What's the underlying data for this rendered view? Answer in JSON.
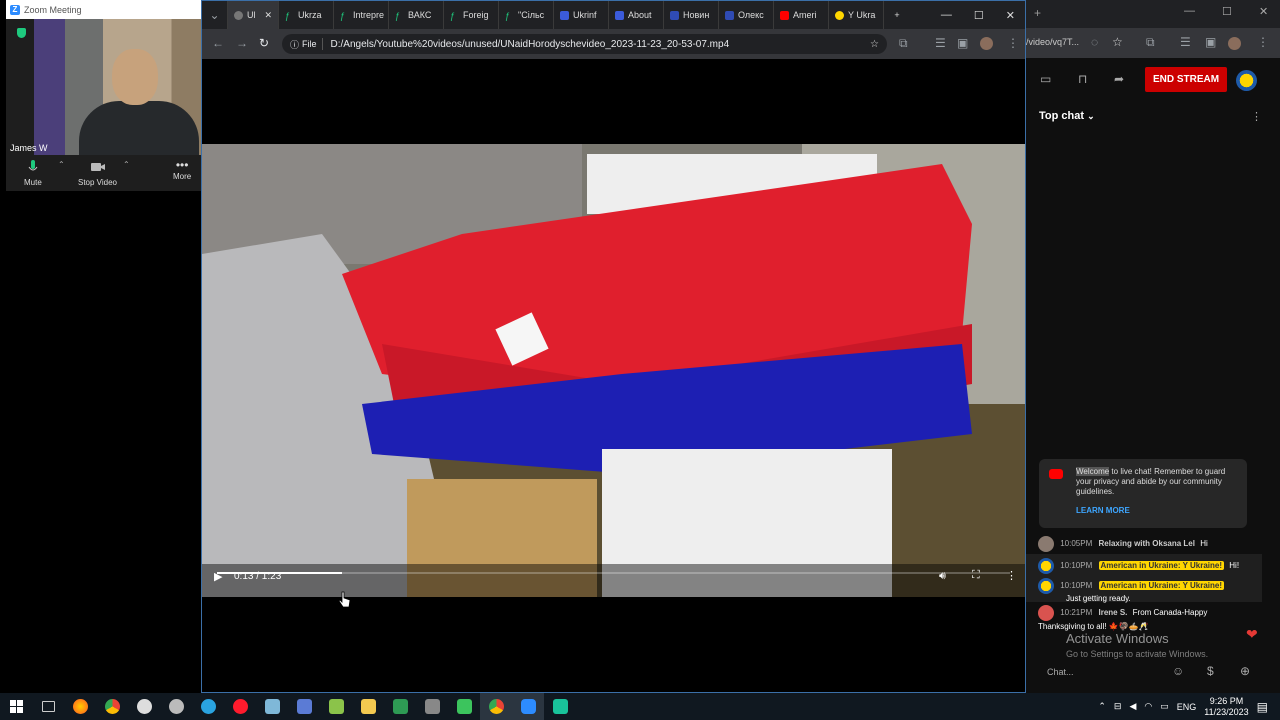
{
  "zoom": {
    "title": "Zoom Meeting",
    "participant_name": "James W",
    "controls": {
      "mute": "Mute",
      "stop_video": "Stop Video",
      "more": "More"
    }
  },
  "chrome": {
    "tabs": [
      {
        "label": "Ul",
        "active": true
      },
      {
        "label": "Ukrza"
      },
      {
        "label": "Intrepre"
      },
      {
        "label": "ВАКС"
      },
      {
        "label": "Foreig"
      },
      {
        "label": "\"Сільс"
      },
      {
        "label": "Ukrinf"
      },
      {
        "label": "About"
      },
      {
        "label": "Новин"
      },
      {
        "label": "Олекс"
      },
      {
        "label": "Ameri"
      },
      {
        "label": "Y Ukra"
      }
    ],
    "address_scheme": "File",
    "address_url": "D:/Angels/Youtube%20videos/unused/UNaidHorodyschevideo_2023-11-23_20-53-07.mp4",
    "video_time": "0:13 / 1:23",
    "video_progress": 0.157
  },
  "youtube": {
    "url_fragment": "/video/vq7T...",
    "end_stream_label": "END STREAM",
    "chat_mode": "Top chat",
    "welcome_highlight": "Welcome",
    "welcome_text": " to live chat! Remember to guard your privacy and abide by our community guidelines.",
    "learn_more": "LEARN MORE",
    "messages": [
      {
        "time": "10:05PM",
        "author": "Relaxing with Oksana Lel",
        "text": "Hi"
      },
      {
        "time": "10:10PM",
        "author": "American in Ukraine: Y Ukraine!",
        "text": "Hi!"
      },
      {
        "time": "10:10PM",
        "author": "American in Ukraine: Y Ukraine!",
        "text": "Just getting ready."
      },
      {
        "time": "10:21PM",
        "author": "Irene S.",
        "text": "From Canada-Happy Thanksgiving to all!"
      }
    ],
    "chat_placeholder": "Chat...",
    "activate_title": "Activate Windows",
    "activate_sub": "Go to Settings to activate Windows."
  },
  "taskbar": {
    "lang": "ENG",
    "time": "9:26 PM",
    "date": "11/23/2023"
  },
  "colors": {
    "zoom_blue": "#2d8cff",
    "end_stream_red": "#cc0000",
    "chip_yellow": "#ffd600"
  }
}
